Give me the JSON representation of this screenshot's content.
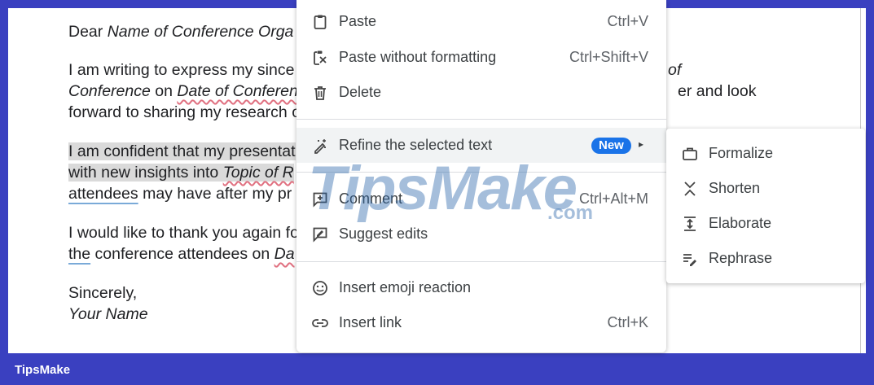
{
  "document": {
    "greeting": [
      "Dear ",
      "Name of Conference Orga"
    ],
    "p1": {
      "l1": "I am writing to express my since",
      "l1_tail": "of",
      "l2": [
        "Conference",
        " on ",
        "Date of Conferen"
      ],
      "l2_tail": "er and look",
      "l3": "forward to sharing my research o"
    },
    "p2": {
      "l1": "I am confident that my presentat",
      "l2": [
        "with new insights into ",
        "Topic of R"
      ],
      "l3": [
        "attendees",
        " may have after my pr"
      ]
    },
    "p3": {
      "l1": "I would like to thank you again fo",
      "l2": [
        "the",
        " conference attendees on ",
        "Da"
      ]
    },
    "closing": "Sincerely,",
    "signature": "Your Name"
  },
  "context_menu": {
    "paste": {
      "label": "Paste",
      "shortcut": "Ctrl+V",
      "icon": "clipboard-icon"
    },
    "paste_plain": {
      "label": "Paste without formatting",
      "shortcut": "Ctrl+Shift+V",
      "icon": "paste-no-format-icon"
    },
    "delete": {
      "label": "Delete",
      "icon": "trash-icon"
    },
    "refine": {
      "label": "Refine the selected text",
      "badge": "New",
      "arrow": "▸",
      "icon": "magic-pen-icon"
    },
    "comment": {
      "label": "Comment",
      "shortcut": "Ctrl+Alt+M",
      "icon": "comment-add-icon"
    },
    "suggest": {
      "label": "Suggest edits",
      "icon": "suggest-edit-icon"
    },
    "emoji": {
      "label": "Insert emoji reaction",
      "icon": "emoji-icon"
    },
    "link": {
      "label": "Insert link",
      "shortcut": "Ctrl+K",
      "icon": "link-icon"
    }
  },
  "refine_submenu": [
    {
      "label": "Formalize",
      "icon": "briefcase-icon"
    },
    {
      "label": "Shorten",
      "icon": "shorten-icon"
    },
    {
      "label": "Elaborate",
      "icon": "elaborate-icon"
    },
    {
      "label": "Rephrase",
      "icon": "rephrase-icon"
    }
  ],
  "watermark": {
    "main": "TipsMake",
    "suffix": ".com"
  },
  "footer_brand": "TipsMake",
  "colors": {
    "frame": "#3a40c0",
    "badge": "#1a73e8",
    "highlight": "#dadada"
  }
}
